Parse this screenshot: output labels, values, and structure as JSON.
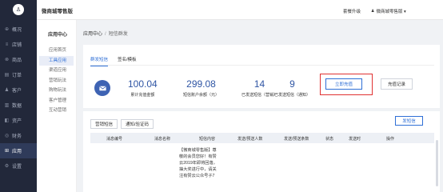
{
  "nav": {
    "logo": "♙",
    "items": [
      {
        "icon": "⊕",
        "label": "概况"
      },
      {
        "icon": "≡",
        "label": "店铺"
      },
      {
        "icon": "⊗",
        "label": "商品"
      },
      {
        "icon": "▤",
        "label": "订单"
      },
      {
        "icon": "♟",
        "label": "客户"
      },
      {
        "icon": "▥",
        "label": "数据"
      },
      {
        "icon": "◧",
        "label": "资产"
      },
      {
        "icon": "◎",
        "label": "财务"
      },
      {
        "icon": "⊞",
        "label": "应用"
      },
      {
        "icon": "⚙",
        "label": "设置"
      }
    ]
  },
  "header": {
    "store_name": "微商城零售版",
    "upgrade": "套餐升级",
    "user_icon": "♟",
    "user": "微商城零售版 ▾"
  },
  "subnav": {
    "title": "应用中心",
    "items": [
      "应用首页",
      "工具应用",
      "渠道应用",
      "营销玩法",
      "购物玩法",
      "客户管理",
      "互动营销"
    ]
  },
  "breadcrumb": {
    "root": "应用中心",
    "sep": "/",
    "current": "短信群发"
  },
  "tabs": [
    "群发短信",
    "签名/模板"
  ],
  "stats": [
    {
      "value": "100.04",
      "label": "累计充值金额"
    },
    {
      "value": "299.08",
      "label": "短信账户余额（元）"
    },
    {
      "value": "14",
      "label": "已发送短信（营销）"
    },
    {
      "value": "9",
      "label": "已发送短信（通知）"
    }
  ],
  "buttons": {
    "recharge": "立即充值",
    "records": "充值记录",
    "send": "发短信"
  },
  "tools": [
    "营销短信",
    "通知/验证码"
  ],
  "table": {
    "columns": [
      "消息编号",
      "消息名称",
      "短信内容",
      "发送/预送人数",
      "发送/预送条数",
      "状态",
      "发送时",
      "操作"
    ],
    "cell_lines": [
      "【微商城零售版】尊",
      "敬的会员您好！有赞",
      "云2019年即将回落，",
      "抽大奖进行中，请关",
      "注有赞云公众号子7"
    ]
  }
}
